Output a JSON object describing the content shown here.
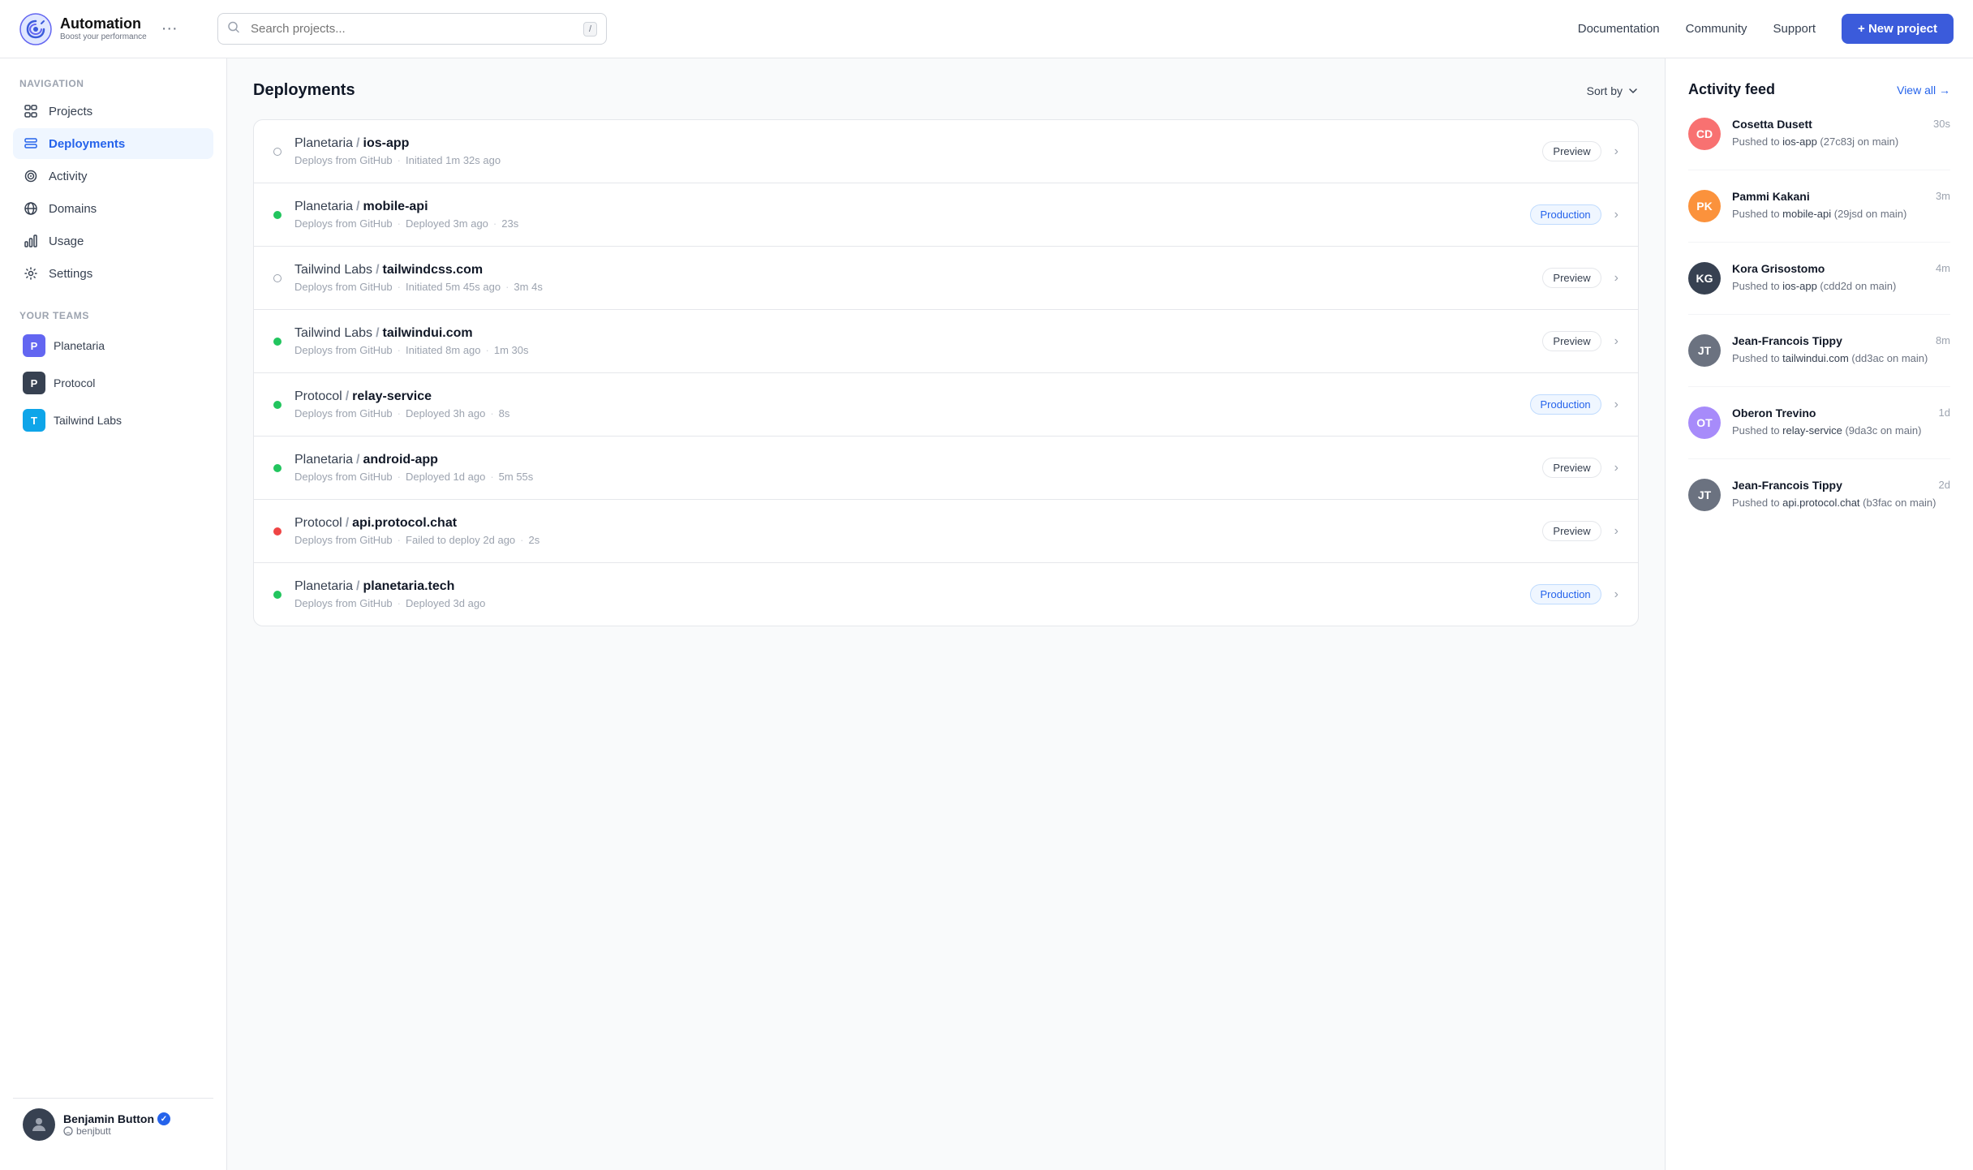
{
  "app": {
    "name": "Automation",
    "tagline": "Boost your performance"
  },
  "topbar": {
    "search_placeholder": "Search projects...",
    "search_kbd": "/",
    "nav_links": [
      "Documentation",
      "Community",
      "Support"
    ],
    "new_project_label": "+ New project"
  },
  "sidebar": {
    "navigation_label": "Navigation",
    "items": [
      {
        "id": "projects",
        "label": "Projects"
      },
      {
        "id": "deployments",
        "label": "Deployments",
        "active": true
      },
      {
        "id": "activity",
        "label": "Activity"
      },
      {
        "id": "domains",
        "label": "Domains"
      },
      {
        "id": "usage",
        "label": "Usage"
      },
      {
        "id": "settings",
        "label": "Settings"
      }
    ],
    "teams_label": "Your teams",
    "teams": [
      {
        "id": "planetaria",
        "label": "Planetaria",
        "initial": "P",
        "color": "#6366f1"
      },
      {
        "id": "protocol",
        "label": "Protocol",
        "initial": "P",
        "color": "#374151"
      },
      {
        "id": "tailwind",
        "label": "Tailwind Labs",
        "initial": "T",
        "color": "#0ea5e9"
      }
    ],
    "user": {
      "name": "Benjamin Button",
      "handle": "benjbutt",
      "verified": true
    }
  },
  "deployments": {
    "title": "Deployments",
    "sort_by_label": "Sort by",
    "rows": [
      {
        "org": "Planetaria",
        "name": "ios-app",
        "status": "gray",
        "source": "Deploys from GitHub",
        "time": "Initiated 1m 32s ago",
        "duration": null,
        "badge": "Preview"
      },
      {
        "org": "Planetaria",
        "name": "mobile-api",
        "status": "green",
        "source": "Deploys from GitHub",
        "time": "Deployed 3m ago",
        "duration": "23s",
        "badge": "Production"
      },
      {
        "org": "Tailwind Labs",
        "name": "tailwindcss.com",
        "status": "gray",
        "source": "Deploys from GitHub",
        "time": "Initiated 5m 45s ago",
        "duration": "3m 4s",
        "badge": "Preview"
      },
      {
        "org": "Tailwind Labs",
        "name": "tailwindui.com",
        "status": "green",
        "source": "Deploys from GitHub",
        "time": "Initiated 8m ago",
        "duration": "1m 30s",
        "badge": "Preview"
      },
      {
        "org": "Protocol",
        "name": "relay-service",
        "status": "green",
        "source": "Deploys from GitHub",
        "time": "Deployed 3h ago",
        "duration": "8s",
        "badge": "Production"
      },
      {
        "org": "Planetaria",
        "name": "android-app",
        "status": "green",
        "source": "Deploys from GitHub",
        "time": "Deployed 1d ago",
        "duration": "5m 55s",
        "badge": "Preview"
      },
      {
        "org": "Protocol",
        "name": "api.protocol.chat",
        "status": "red",
        "source": "Deploys from GitHub",
        "time": "Failed to deploy 2d ago",
        "duration": "2s",
        "badge": "Preview"
      },
      {
        "org": "Planetaria",
        "name": "planetaria.tech",
        "status": "green",
        "source": "Deploys from GitHub",
        "time": "Deployed 3d ago",
        "duration": null,
        "badge": "Production"
      }
    ]
  },
  "activity": {
    "title": "Activity feed",
    "view_all": "View all →",
    "items": [
      {
        "name": "Cosetta Dusett",
        "time": "30s",
        "desc_prefix": "Pushed to ",
        "repo": "ios-app",
        "commit": "27c83j",
        "branch": "main",
        "color": "#f87171"
      },
      {
        "name": "Pammi Kakani",
        "time": "3m",
        "desc_prefix": "Pushed to ",
        "repo": "mobile-api",
        "commit": "29jsd",
        "branch": "main",
        "color": "#fb923c"
      },
      {
        "name": "Kora Grisostomo",
        "time": "4m",
        "desc_prefix": "Pushed to ",
        "repo": "ios-app",
        "commit": "cdd2d",
        "branch": "main",
        "color": "#374151"
      },
      {
        "name": "Jean-Francois Tippy",
        "time": "8m",
        "desc_prefix": "Pushed to ",
        "repo": "tailwindui.com",
        "commit": "dd3ac",
        "branch": "main",
        "color": "#6b7280"
      },
      {
        "name": "Oberon Trevino",
        "time": "1d",
        "desc_prefix": "Pushed to ",
        "repo": "relay-service",
        "commit": "9da3c",
        "branch": "main",
        "color": "#a78bfa"
      },
      {
        "name": "Jean-Francois Tippy",
        "time": "2d",
        "desc_prefix": "Pushed to ",
        "repo": "api.protocol.chat",
        "commit": "b3fac",
        "branch": "main",
        "color": "#6b7280"
      }
    ]
  }
}
